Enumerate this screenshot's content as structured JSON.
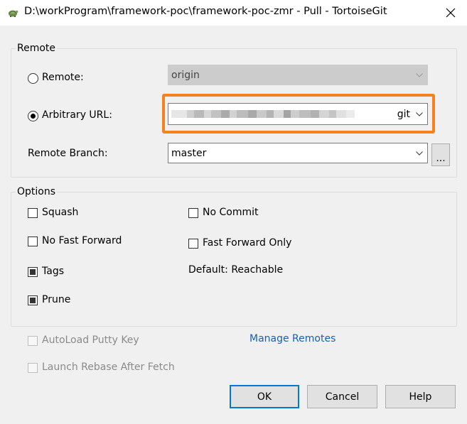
{
  "window": {
    "title": "D:\\workProgram\\framework-poc\\framework-poc-zmr - Pull - TortoiseGit",
    "app_icon": "tortoisegit-icon",
    "close_icon": "close-icon"
  },
  "remote_group": {
    "legend": "Remote",
    "remote_radio_label": "Remote:",
    "remote_radio_checked": false,
    "remote_value": "origin",
    "arbitrary_radio_label": "Arbitrary URL:",
    "arbitrary_radio_checked": true,
    "arbitrary_url_visible_suffix": "git",
    "branch_label": "Remote Branch:",
    "branch_value": "master",
    "browse_label": "..."
  },
  "options_group": {
    "legend": "Options",
    "squash": {
      "label": "Squash",
      "checked": false
    },
    "no_commit": {
      "label": "No Commit",
      "checked": false
    },
    "no_fast_forward": {
      "label": "No Fast Forward",
      "checked": false
    },
    "fast_forward_only": {
      "label": "Fast Forward Only",
      "checked": false
    },
    "tags": {
      "label": "Tags",
      "checked": true
    },
    "default_text": "Default: Reachable",
    "prune": {
      "label": "Prune",
      "checked": true
    }
  },
  "footer": {
    "autoload_putty_key": {
      "label": "AutoLoad Putty Key",
      "checked": false,
      "disabled": true
    },
    "launch_rebase": {
      "label": "Launch Rebase After Fetch",
      "checked": false,
      "disabled": true
    },
    "manage_remotes": "Manage Remotes",
    "ok": "OK",
    "cancel": "Cancel",
    "help": "Help"
  },
  "colors": {
    "highlight": "#f58220",
    "link": "#1a5fb4",
    "focus": "#0078d7"
  }
}
